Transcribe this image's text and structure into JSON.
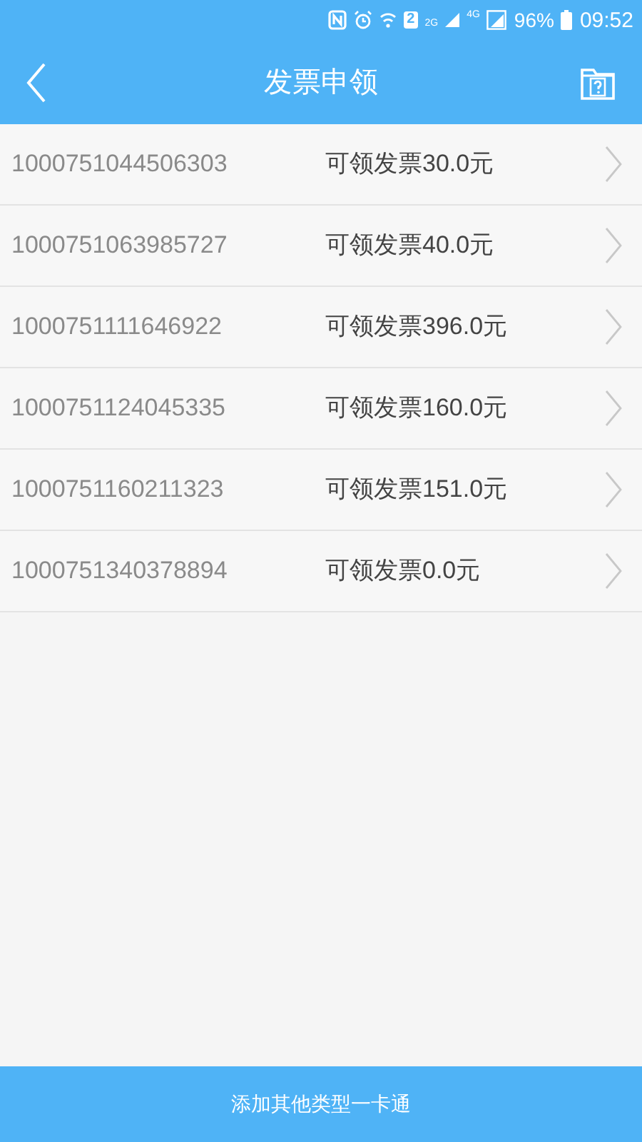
{
  "status_bar": {
    "sim_badge": "2",
    "network_1": "2G",
    "network_2": "4G",
    "battery": "96%",
    "time": "09:52"
  },
  "header": {
    "title": "发票申领"
  },
  "cards": [
    {
      "number": "1000751044506303",
      "invoice": "可领发票30.0元"
    },
    {
      "number": "1000751063985727",
      "invoice": "可领发票40.0元"
    },
    {
      "number": "1000751111646922",
      "invoice": "可领发票396.0元"
    },
    {
      "number": "1000751124045335",
      "invoice": "可领发票160.0元"
    },
    {
      "number": "1000751160211323",
      "invoice": "可领发票151.0元"
    },
    {
      "number": "1000751340378894",
      "invoice": "可领发票0.0元"
    }
  ],
  "bottom_button": "添加其他类型一卡通"
}
